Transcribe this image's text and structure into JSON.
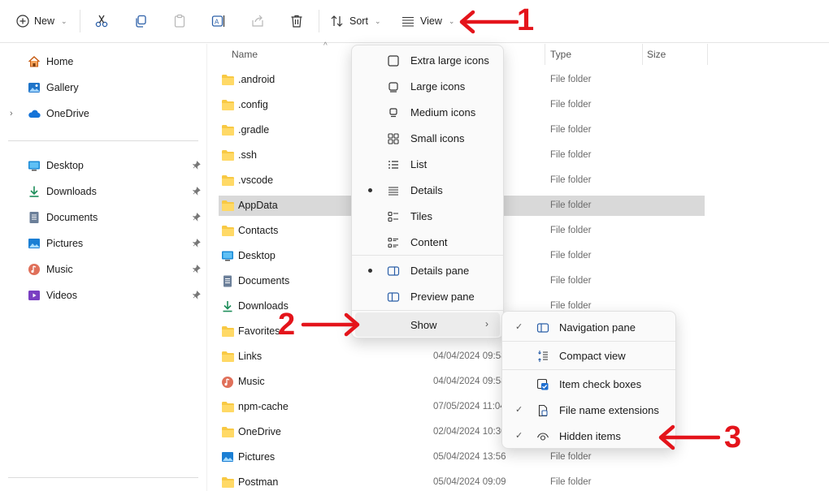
{
  "toolbar": {
    "new_label": "New",
    "sort_label": "Sort",
    "view_label": "View"
  },
  "sidebar": {
    "top": [
      {
        "label": "Home",
        "icon": "home-icon"
      },
      {
        "label": "Gallery",
        "icon": "gallery-icon"
      },
      {
        "label": "OneDrive",
        "icon": "cloud-icon"
      }
    ],
    "pinned": [
      {
        "label": "Desktop",
        "icon": "desktop-icon"
      },
      {
        "label": "Downloads",
        "icon": "download-icon"
      },
      {
        "label": "Documents",
        "icon": "documents-icon"
      },
      {
        "label": "Pictures",
        "icon": "pictures-icon"
      },
      {
        "label": "Music",
        "icon": "music-icon"
      },
      {
        "label": "Videos",
        "icon": "videos-icon"
      }
    ]
  },
  "columns": {
    "name": "Name",
    "type": "Type",
    "size": "Size"
  },
  "files": [
    {
      "name": ".android",
      "date": "",
      "type": "File folder",
      "icon": "folder-icon"
    },
    {
      "name": ".config",
      "date": "",
      "type": "File folder",
      "icon": "folder-icon"
    },
    {
      "name": ".gradle",
      "date": "",
      "type": "File folder",
      "icon": "folder-icon"
    },
    {
      "name": ".ssh",
      "date": "",
      "type": "File folder",
      "icon": "folder-icon"
    },
    {
      "name": ".vscode",
      "date": "",
      "type": "File folder",
      "icon": "folder-icon"
    },
    {
      "name": "AppData",
      "date": "",
      "type": "File folder",
      "icon": "folder-icon",
      "selected": true
    },
    {
      "name": "Contacts",
      "date": "",
      "type": "File folder",
      "icon": "folder-icon"
    },
    {
      "name": "Desktop",
      "date": "",
      "type": "File folder",
      "icon": "desktop-icon"
    },
    {
      "name": "Documents",
      "date": "",
      "type": "File folder",
      "icon": "documents-icon"
    },
    {
      "name": "Downloads",
      "date": "",
      "type": "File folder",
      "icon": "download-icon"
    },
    {
      "name": "Favorites",
      "date": "",
      "type": "",
      "icon": "folder-icon"
    },
    {
      "name": "Links",
      "date": "04/04/2024 09:58",
      "type": "",
      "icon": "folder-icon"
    },
    {
      "name": "Music",
      "date": "04/04/2024 09:58",
      "type": "",
      "icon": "music-icon"
    },
    {
      "name": "npm-cache",
      "date": "07/05/2024 11:04",
      "type": "",
      "icon": "folder-icon"
    },
    {
      "name": "OneDrive",
      "date": "02/04/2024 10:30",
      "type": "",
      "icon": "folder-icon"
    },
    {
      "name": "Pictures",
      "date": "05/04/2024 13:56",
      "type": "File folder",
      "icon": "pictures-icon"
    },
    {
      "name": "Postman",
      "date": "05/04/2024 09:09",
      "type": "File folder",
      "icon": "folder-icon"
    }
  ],
  "view_menu": {
    "items": [
      {
        "label": "Extra large icons",
        "icon": "extra-large-icons-icon"
      },
      {
        "label": "Large icons",
        "icon": "large-icons-icon"
      },
      {
        "label": "Medium icons",
        "icon": "medium-icons-icon"
      },
      {
        "label": "Small icons",
        "icon": "small-icons-icon"
      },
      {
        "label": "List",
        "icon": "list-icon"
      },
      {
        "label": "Details",
        "icon": "details-icon",
        "active": true
      },
      {
        "label": "Tiles",
        "icon": "tiles-icon"
      },
      {
        "label": "Content",
        "icon": "content-icon"
      },
      {
        "label": "Details pane",
        "icon": "details-pane-icon",
        "active": true
      },
      {
        "label": "Preview pane",
        "icon": "preview-pane-icon"
      },
      {
        "label": "Show",
        "icon": "",
        "submenu": true
      }
    ]
  },
  "show_menu": {
    "items": [
      {
        "label": "Navigation pane",
        "checked": true,
        "icon": "navigation-pane-icon"
      },
      {
        "label": "Compact view",
        "checked": false,
        "icon": "compact-view-icon"
      },
      {
        "label": "Item check boxes",
        "checked": false,
        "icon": "check-boxes-icon"
      },
      {
        "label": "File name extensions",
        "checked": true,
        "icon": "file-extensions-icon"
      },
      {
        "label": "Hidden items",
        "checked": true,
        "icon": "hidden-items-icon"
      }
    ]
  },
  "annotations": {
    "one": "1",
    "two": "2",
    "three": "3"
  },
  "colors": {
    "annotation_red": "#e4141b",
    "folder_yellow": "#f8c944",
    "selection": "#d9d9d9"
  }
}
